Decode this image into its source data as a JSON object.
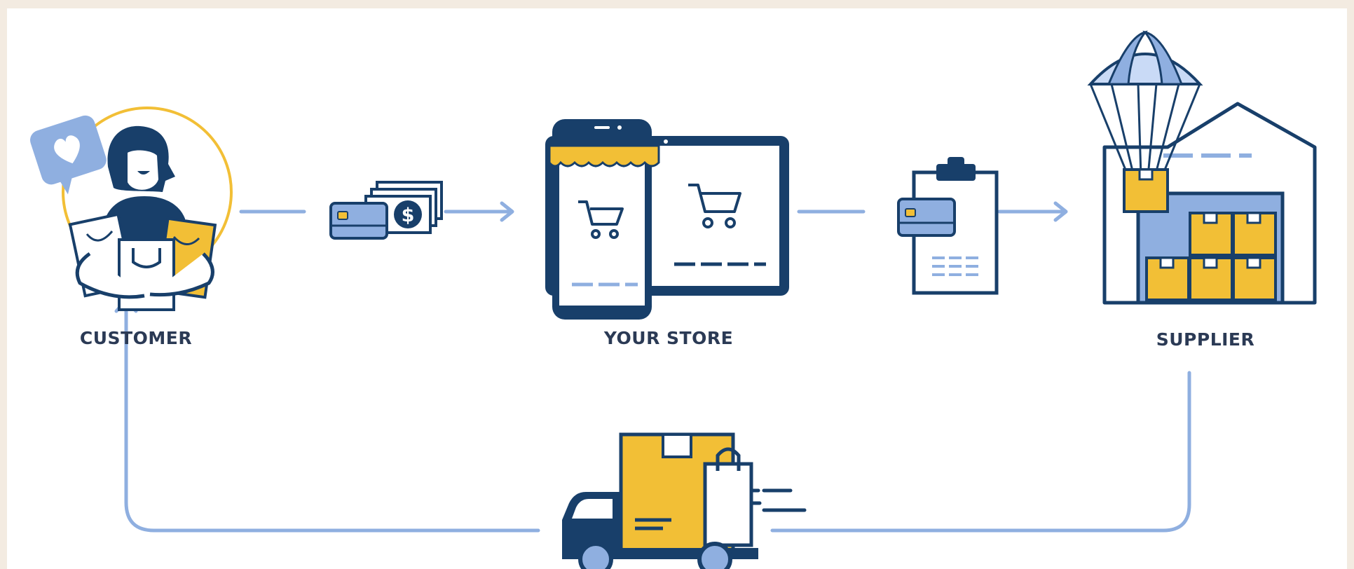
{
  "nodes": {
    "customer": {
      "label": "CUSTOMER"
    },
    "store": {
      "label": "YOUR STORE"
    },
    "supplier": {
      "label": "SUPPLIER"
    }
  },
  "icons": {
    "customer": "customer-with-shopping-bags-icon",
    "heart_bubble": "heart-speech-bubble-icon",
    "payment": "credit-card-and-cash-icon",
    "store": "phone-and-tablet-storefront-icon",
    "order": "clipboard-order-icon",
    "supplier": "warehouse-with-parachute-icon",
    "delivery": "delivery-truck-icon"
  },
  "colors": {
    "navy": "#183f6a",
    "light_blue": "#8fafe0",
    "pale_blue": "#c9daf6",
    "yellow": "#f2bf36",
    "background": "#f3ebe1"
  }
}
